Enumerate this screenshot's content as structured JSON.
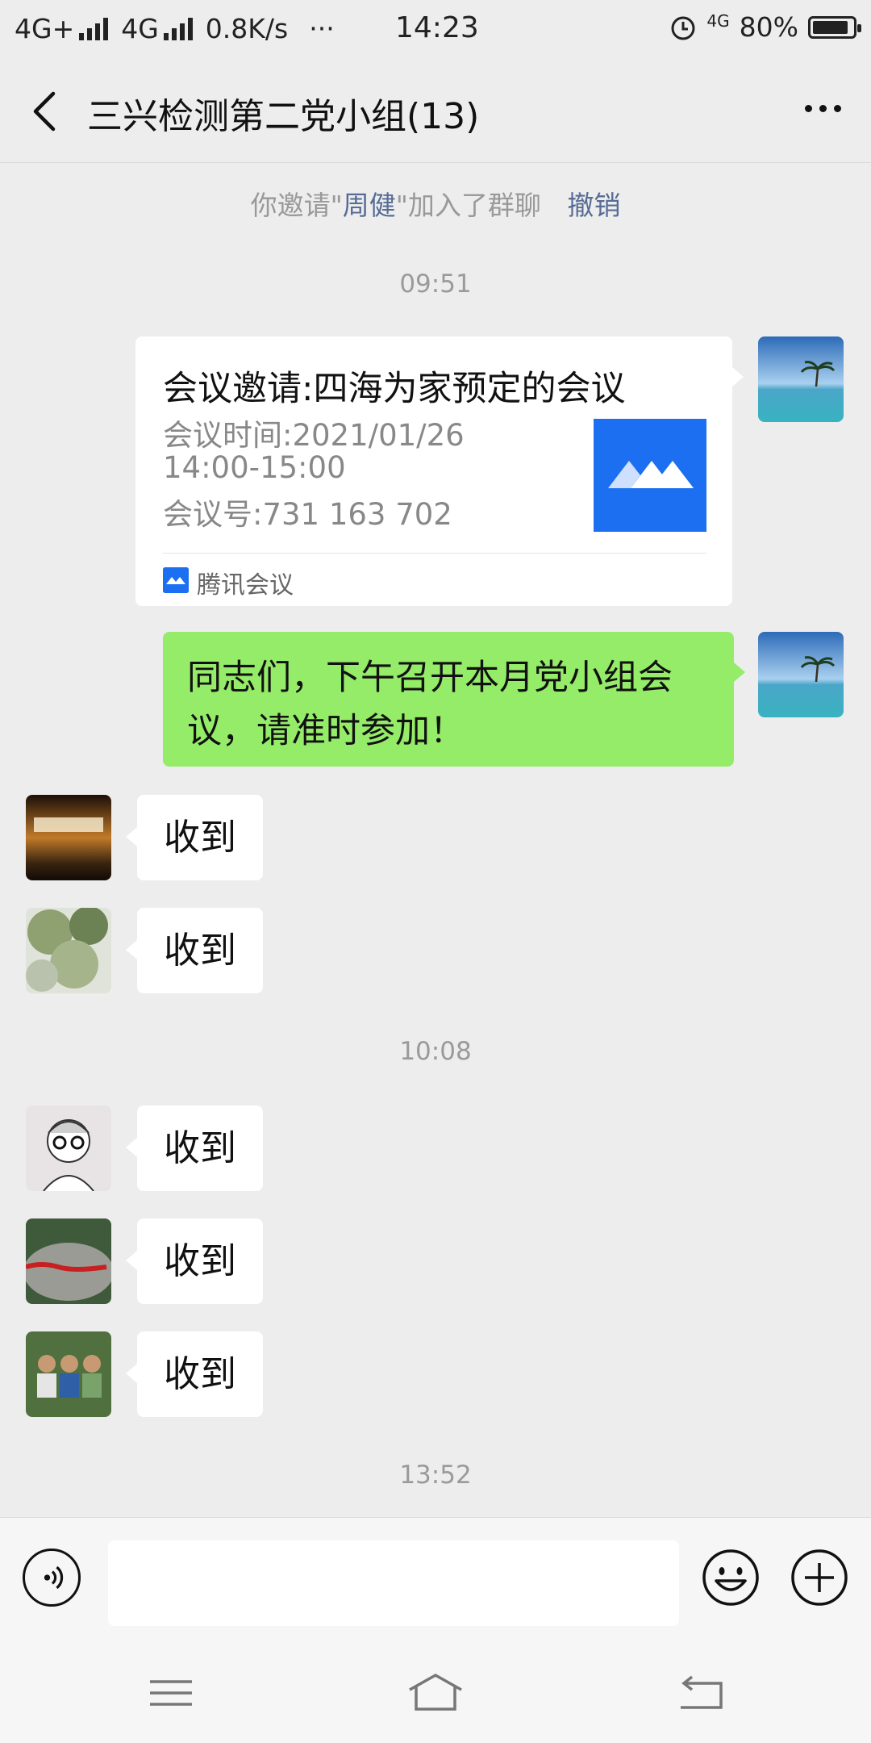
{
  "status_bar": {
    "left_text": "4G+",
    "network2": "4G",
    "speed": "0.8K/s",
    "dots": "···",
    "time": "14:23",
    "net_badge": "4G",
    "battery": "80%"
  },
  "header": {
    "title": "三兴检测第二党小组(13)"
  },
  "system_message": {
    "prefix": "你邀请\"",
    "name": "周健",
    "suffix": "\"加入了群聊",
    "action": "撤销"
  },
  "timestamps": [
    "09:51",
    "10:08",
    "13:52"
  ],
  "meeting_card": {
    "title": "会议邀请:四海为家预定的会议",
    "time_line": "会议时间:2021/01/26",
    "time_range": "14:00-15:00",
    "meeting_id": "会议号:731 163 702",
    "source": "腾讯会议"
  },
  "outgoing_message": "同志们，下午召开本月党小组会议，请准时参加！",
  "replies": [
    "收到",
    "收到",
    "收到",
    "收到",
    "收到"
  ],
  "colors": {
    "bg": "#ededed",
    "outgoing_bubble": "#95ec69",
    "link_blue": "#576b95",
    "tencent_meeting_blue": "#1c6ff0"
  },
  "icons": [
    "back-icon",
    "more-icon",
    "voice-icon",
    "emoji-icon",
    "plus-icon",
    "menu-icon",
    "home-icon",
    "return-icon"
  ]
}
